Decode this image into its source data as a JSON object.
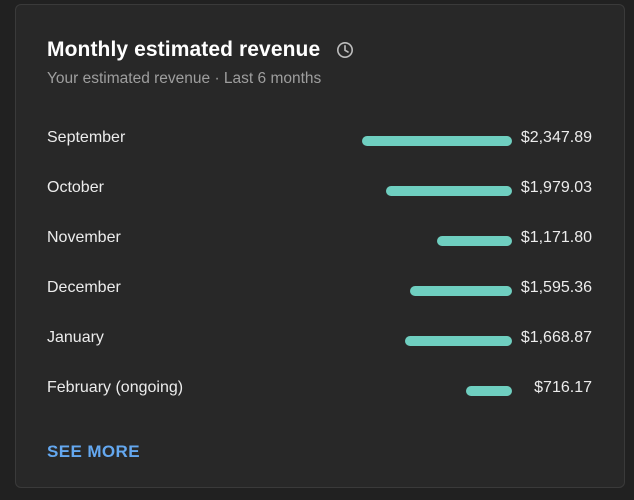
{
  "card": {
    "title": "Monthly estimated revenue",
    "subtitle": "Your estimated revenue · Last 6 months",
    "see_more_label": "SEE MORE"
  },
  "colors": {
    "bar": "#6fcfc0",
    "link": "#64a8f0"
  },
  "icons": {
    "title_icon": "clock-icon"
  },
  "chart_data": {
    "type": "bar",
    "categories": [
      "September",
      "October",
      "November",
      "December",
      "January",
      "February (ongoing)"
    ],
    "values": [
      2347.89,
      1979.03,
      1171.8,
      1595.36,
      1668.87,
      716.17
    ],
    "value_labels": [
      "$2,347.89",
      "$1,979.03",
      "$1,171.80",
      "$1,595.36",
      "$1,668.87",
      "$716.17"
    ]
  }
}
